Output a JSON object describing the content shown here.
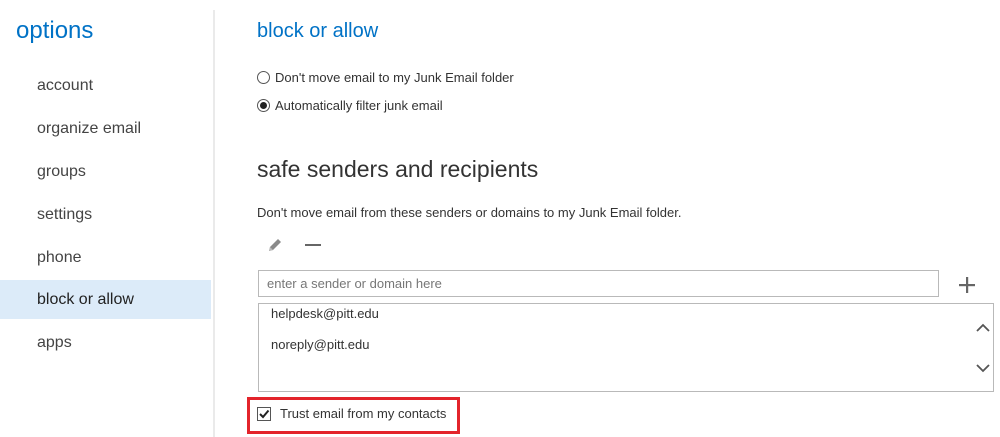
{
  "sidebar": {
    "title": "options",
    "items": [
      {
        "label": "account",
        "active": false
      },
      {
        "label": "organize email",
        "active": false
      },
      {
        "label": "groups",
        "active": false
      },
      {
        "label": "settings",
        "active": false
      },
      {
        "label": "phone",
        "active": false
      },
      {
        "label": "block or allow",
        "active": true
      },
      {
        "label": "apps",
        "active": false
      }
    ]
  },
  "main": {
    "title": "block or allow",
    "junk_options": [
      {
        "label": "Don't move email to my Junk Email folder",
        "selected": false
      },
      {
        "label": "Automatically filter junk email",
        "selected": true
      }
    ],
    "safe_senders": {
      "heading": "safe senders and recipients",
      "description": "Don't move email from these senders or domains to my Junk Email folder.",
      "input_placeholder": "enter a sender or domain here",
      "input_value": "",
      "entries": [
        "helpdesk@pitt.edu",
        "noreply@pitt.edu"
      ],
      "trust_contacts_label": "Trust email from my contacts",
      "trust_contacts_checked": true
    }
  },
  "icons": {
    "edit": "pencil-icon",
    "remove": "minus-icon",
    "add": "plus-icon",
    "scroll_up": "chevron-up-icon",
    "scroll_down": "chevron-down-icon"
  },
  "colors": {
    "accent": "#0072c6",
    "active_nav_bg": "#dcebf9",
    "highlight": "#e3242b"
  }
}
